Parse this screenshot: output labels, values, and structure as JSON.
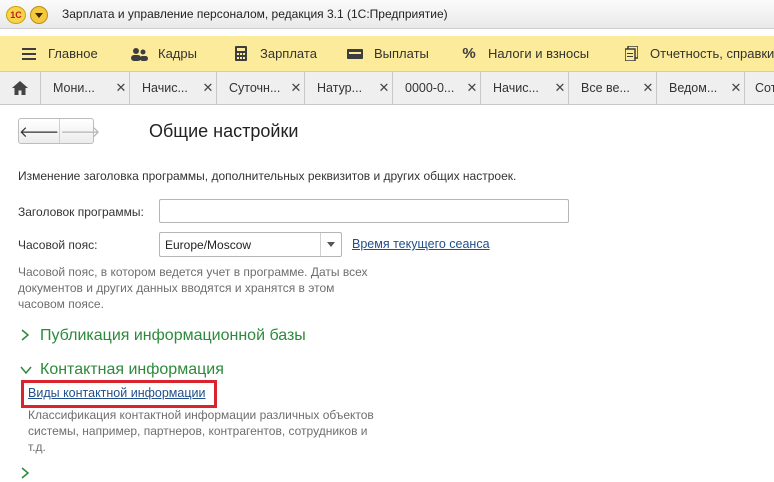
{
  "window": {
    "title": "Зарплата и управление персоналом, редакция 3.1  (1С:Предприятие)",
    "logo_text": "1С"
  },
  "sections": [
    {
      "label": "Главное",
      "icon": "hamburger-icon"
    },
    {
      "label": "Кадры",
      "icon": "people-icon"
    },
    {
      "label": "Зарплата",
      "icon": "calculator-icon"
    },
    {
      "label": "Выплаты",
      "icon": "wallet-icon"
    },
    {
      "label": "Налоги и взносы",
      "icon": "percent-icon"
    },
    {
      "label": "Отчетность, справки",
      "icon": "reports-icon"
    }
  ],
  "tabs": [
    {
      "label": "Мони..."
    },
    {
      "label": "Начис..."
    },
    {
      "label": "Суточн..."
    },
    {
      "label": "Натур..."
    },
    {
      "label": "0000-0..."
    },
    {
      "label": "Начис..."
    },
    {
      "label": "Все ве..."
    },
    {
      "label": "Ведом..."
    },
    {
      "label": "Сот"
    }
  ],
  "page": {
    "title": "Общие настройки",
    "intro": "Изменение заголовка программы, дополнительных реквизитов и других общих настроек.",
    "program_title_label": "Заголовок программы:",
    "program_title_value": "",
    "timezone_label": "Часовой пояс:",
    "timezone_value": "Europe/Moscow",
    "session_time_link": "Время текущего сеанса",
    "timezone_desc": [
      "Часовой пояс, в котором ведется учет в программе. Даты всех",
      "документов и других данных вводятся и хранятся в этом",
      "часовом поясе."
    ],
    "group_publication": "Публикация информационной базы",
    "group_contact": "Контактная информация",
    "contact_kinds_link": "Виды контактной информации",
    "contact_desc": [
      "Классификация контактной информации различных объектов",
      "системы, например, партнеров, контрагентов, сотрудников и",
      "т.д."
    ]
  },
  "colors": {
    "sections_bg": "#fbeb9a",
    "group_green": "#2c8a3a",
    "link_blue": "#1f4f8c",
    "highlight_red": "#d9232d"
  }
}
